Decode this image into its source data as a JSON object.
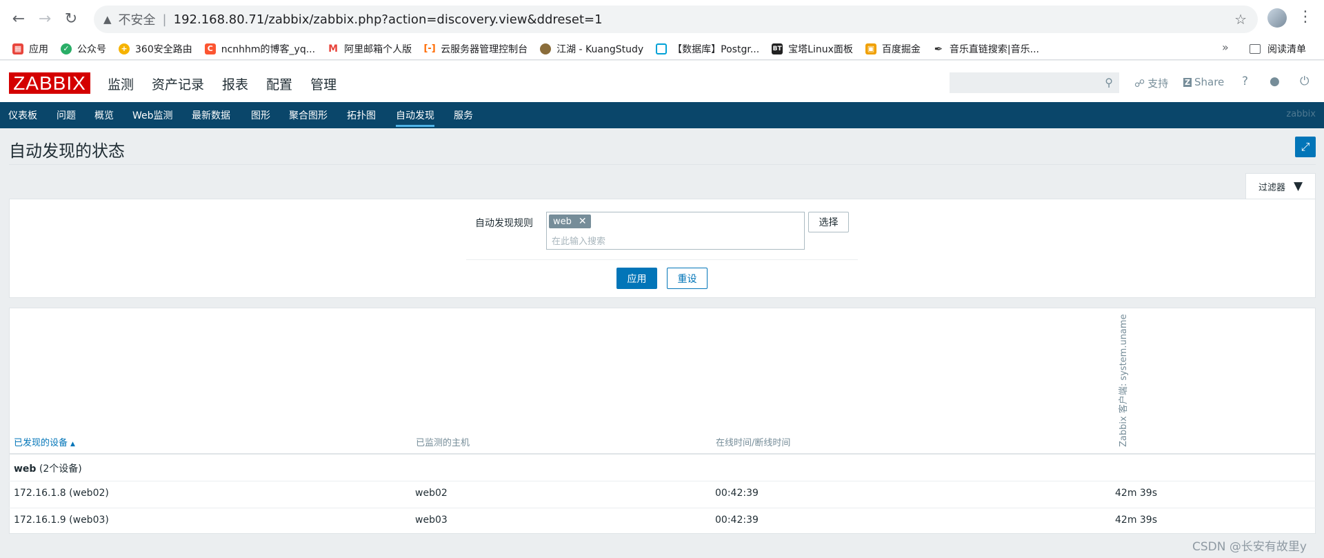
{
  "browser": {
    "security_label": "不安全",
    "url": "192.168.80.71/zabbix/zabbix.php?action=discovery.view&ddreset=1",
    "bookmarks": [
      {
        "label": "应用",
        "icon": "apps-grid-icon",
        "color": "#e8453c"
      },
      {
        "label": "公众号",
        "icon": "wechat-icon",
        "color": "#2aae67"
      },
      {
        "label": "360安全路由",
        "icon": "360-icon",
        "color": "#f6b300"
      },
      {
        "label": "ncnhhm的博客_yq...",
        "icon": "csdn-c-icon",
        "color": "#fc5531"
      },
      {
        "label": "阿里邮箱个人版",
        "icon": "mail-m-icon",
        "color": "#e8453c"
      },
      {
        "label": "云服务器管理控制台",
        "icon": "aliyun-icon",
        "color": "#ff6a00"
      },
      {
        "label": "江湖 - KuangStudy",
        "icon": "avatar-icon",
        "color": "#8a6d3b"
      },
      {
        "label": "【数据库】Postgr...",
        "icon": "bilibili-icon",
        "color": "#00a1d6"
      },
      {
        "label": "宝塔Linux面板",
        "icon": "bt-icon",
        "color": "#222222"
      },
      {
        "label": "百度掘金",
        "icon": "juejin-icon",
        "color": "#f0a000"
      },
      {
        "label": "音乐直链搜索|音乐...",
        "icon": "music-icon",
        "color": "#333333"
      }
    ],
    "reading_list": "阅读清单",
    "overflow": "»"
  },
  "header": {
    "logo": "ZABBIX",
    "menu": [
      "监测",
      "资产记录",
      "报表",
      "配置",
      "管理"
    ],
    "support_label": "支持",
    "share_label": "Share"
  },
  "submenu": {
    "items": [
      "仪表板",
      "问题",
      "概览",
      "Web监测",
      "最新数据",
      "图形",
      "聚合图形",
      "拓扑图",
      "自动发现",
      "服务"
    ],
    "active": "自动发现",
    "brand": "zabbix"
  },
  "page": {
    "title": "自动发现的状态",
    "filter_tab_label": "过滤器"
  },
  "filter": {
    "rule_label": "自动发现规则",
    "selected_tag": "web",
    "placeholder": "在此输入搜索",
    "select_button": "选择",
    "apply_button": "应用",
    "reset_button": "重设"
  },
  "table": {
    "columns": {
      "device": "已发现的设备",
      "host": "已监测的主机",
      "uptime": "在线时间/断线时间",
      "check": "Zabbix 客户端: system.uname"
    },
    "group": {
      "name": "web",
      "count": "(2个设备)"
    },
    "rows": [
      {
        "device": "172.16.1.8 (web02)",
        "host": "web02",
        "uptime": "00:42:39",
        "check": "42m 39s"
      },
      {
        "device": "172.16.1.9 (web03)",
        "host": "web03",
        "uptime": "00:42:39",
        "check": "42m 39s"
      }
    ]
  },
  "watermark": "CSDN @长安有故里y",
  "colors": {
    "brand_red": "#d40000",
    "nav_blue": "#0a466a",
    "accent_blue": "#0275b8"
  }
}
